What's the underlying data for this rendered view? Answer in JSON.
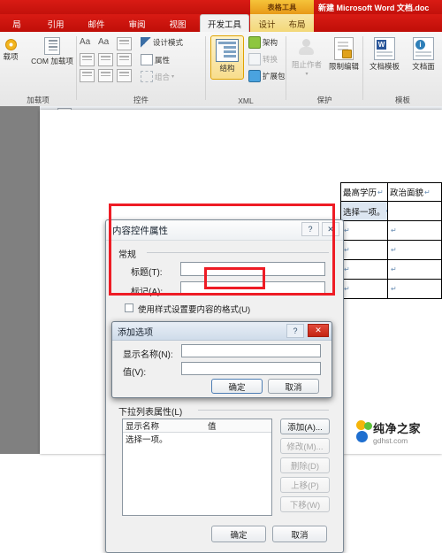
{
  "titlebar": {
    "contextual_tab_group": "表格工具",
    "document_title": "新建 Microsoft Word 文档.doc"
  },
  "ribbon": {
    "tabs": [
      {
        "label": "局",
        "active": false
      },
      {
        "label": "引用",
        "active": false
      },
      {
        "label": "邮件",
        "active": false
      },
      {
        "label": "审阅",
        "active": false
      },
      {
        "label": "视图",
        "active": false
      },
      {
        "label": "开发工具",
        "active": true
      }
    ],
    "contextual_tabs": [
      {
        "label": "设计"
      },
      {
        "label": "布局"
      }
    ],
    "groups": [
      {
        "name": "加载项"
      },
      {
        "name": "控件"
      },
      {
        "name": "XML"
      },
      {
        "name": "保护"
      },
      {
        "name": "模板"
      }
    ],
    "addins": {
      "addin_label": "载项",
      "com_addin_label": "COM 加载项"
    },
    "controls": {
      "design_mode": "设计模式",
      "properties": "属性",
      "group": "组合"
    },
    "xml": {
      "structure": "结构",
      "schema": "架构",
      "transform": "转换",
      "expansion_pack": "扩展包"
    },
    "protect": {
      "block_authors": "阻止作者",
      "restrict_editing": "限制编辑"
    },
    "templates": {
      "document_template": "文档模板",
      "document_panel": "文档面"
    }
  },
  "document_table": {
    "headers": [
      "最高学历",
      "政治面貌"
    ],
    "rows": [
      [
        "选择一项。",
        ""
      ],
      [
        "",
        ""
      ],
      [
        "",
        ""
      ],
      [
        "",
        ""
      ],
      [
        "",
        ""
      ]
    ]
  },
  "dialog_main": {
    "title": "内容控件属性",
    "help_icon": "?",
    "close_icon": "✕",
    "general_section": "常规",
    "fields": [
      {
        "label": "标题(T):",
        "value": ""
      },
      {
        "label": "标记(A):",
        "value": ""
      }
    ],
    "checkbox_style": "使用样式设置要内容的格式(U)",
    "dropdown_section": "下拉列表属性(L)",
    "list_headers": [
      "显示名称",
      "值"
    ],
    "list_rows": [
      {
        "display_name": "选择一项。",
        "value": ""
      }
    ],
    "side_buttons": [
      {
        "label": "添加(A)...",
        "enabled": true
      },
      {
        "label": "修改(M)...",
        "enabled": false
      },
      {
        "label": "删除(D)",
        "enabled": false
      },
      {
        "label": "上移(P)",
        "enabled": false
      },
      {
        "label": "下移(W)",
        "enabled": false
      }
    ],
    "ok_button": "确定",
    "cancel_button": "取消"
  },
  "dialog_add_option": {
    "title": "添加选项",
    "help_icon": "?",
    "close_icon": "✕",
    "fields": [
      {
        "label": "显示名称(N):",
        "value": ""
      },
      {
        "label": "值(V):",
        "value": ""
      }
    ],
    "ok_button": "确定",
    "cancel_button": "取消"
  },
  "annotations": {
    "highlight_color": "#ee1c25",
    "boxes": [
      "add-option-dialog-outline",
      "ok-button-outline"
    ]
  },
  "watermark": {
    "name_cn": "纯净之家",
    "name_en": "gdhst.com"
  }
}
